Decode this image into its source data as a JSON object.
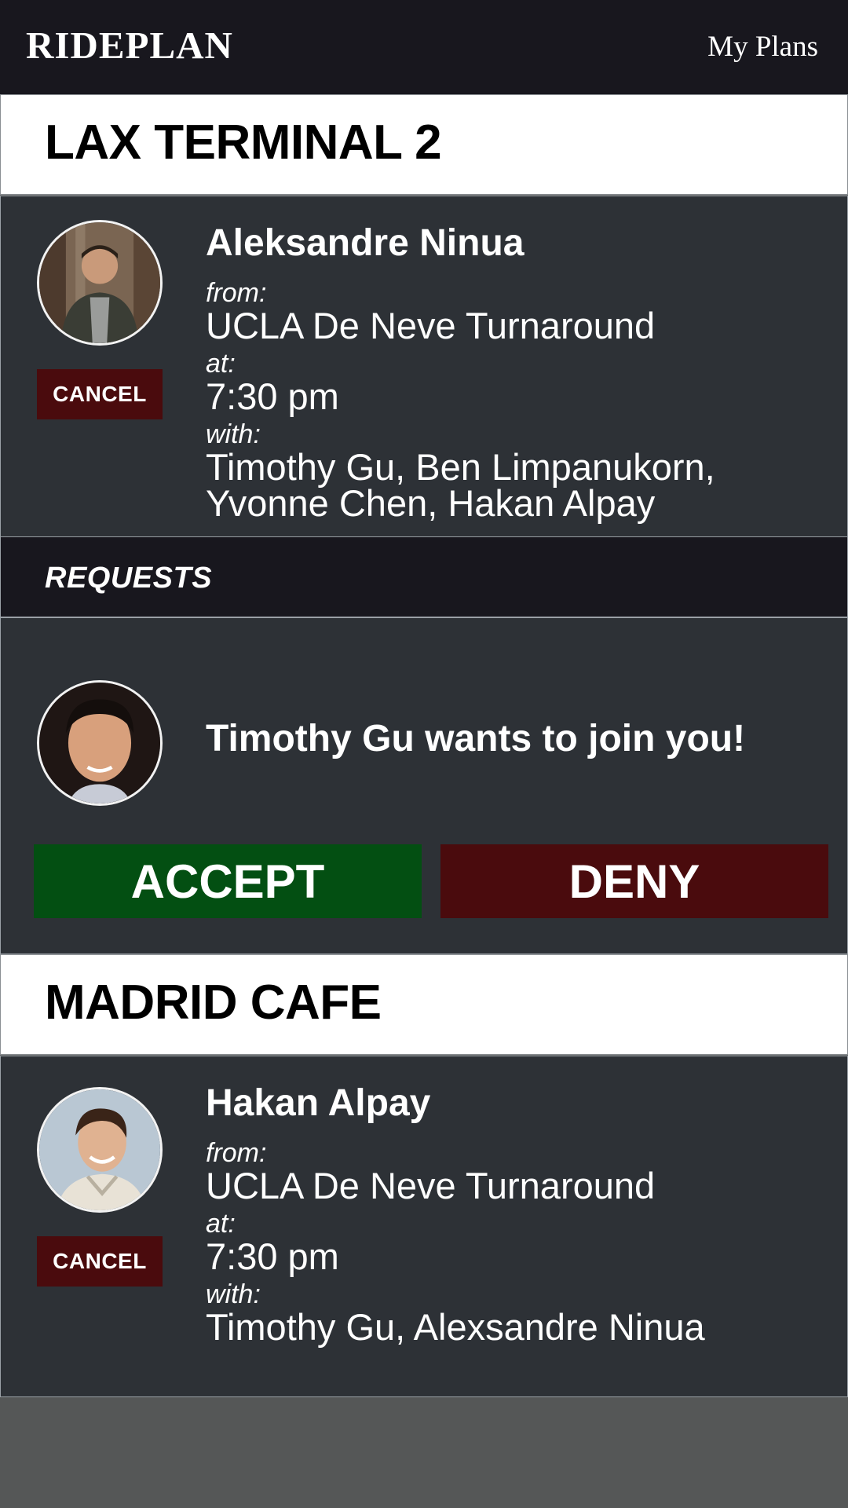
{
  "app": {
    "brand": "RIDEPLAN",
    "nav_link": "My Plans"
  },
  "plans": [
    {
      "destination": "LAX TERMINAL 2",
      "rider": {
        "name": "Aleksandre Ninua",
        "from_label": "from:",
        "from": "UCLA De Neve Turnaround",
        "at_label": "at:",
        "time": "7:30 pm",
        "with_label": "with:",
        "with_line1": "Timothy Gu, Ben Limpanukorn,",
        "with_line2": "Yvonne Chen, Hakan Alpay",
        "cancel_label": "CANCEL"
      },
      "requests": {
        "title": "REQUESTS",
        "items": [
          {
            "message": "Timothy Gu wants to join you!",
            "accept_label": "ACCEPT",
            "deny_label": "DENY"
          }
        ]
      }
    },
    {
      "destination": "MADRID CAFE",
      "rider": {
        "name": "Hakan Alpay",
        "from_label": "from:",
        "from": "UCLA De Neve Turnaround",
        "at_label": "at:",
        "time": "7:30 pm",
        "with_label": "with:",
        "with_line1": "Timothy Gu, Alexsandre Ninua",
        "cancel_label": "CANCEL"
      }
    }
  ],
  "colors": {
    "navbar": "#18171e",
    "card": "#2d3136",
    "cancel": "#4a0b0d",
    "accept": "#034f12",
    "deny": "#4a0b0d",
    "page": "#555757"
  },
  "icons": [
    "avatar-photo"
  ]
}
